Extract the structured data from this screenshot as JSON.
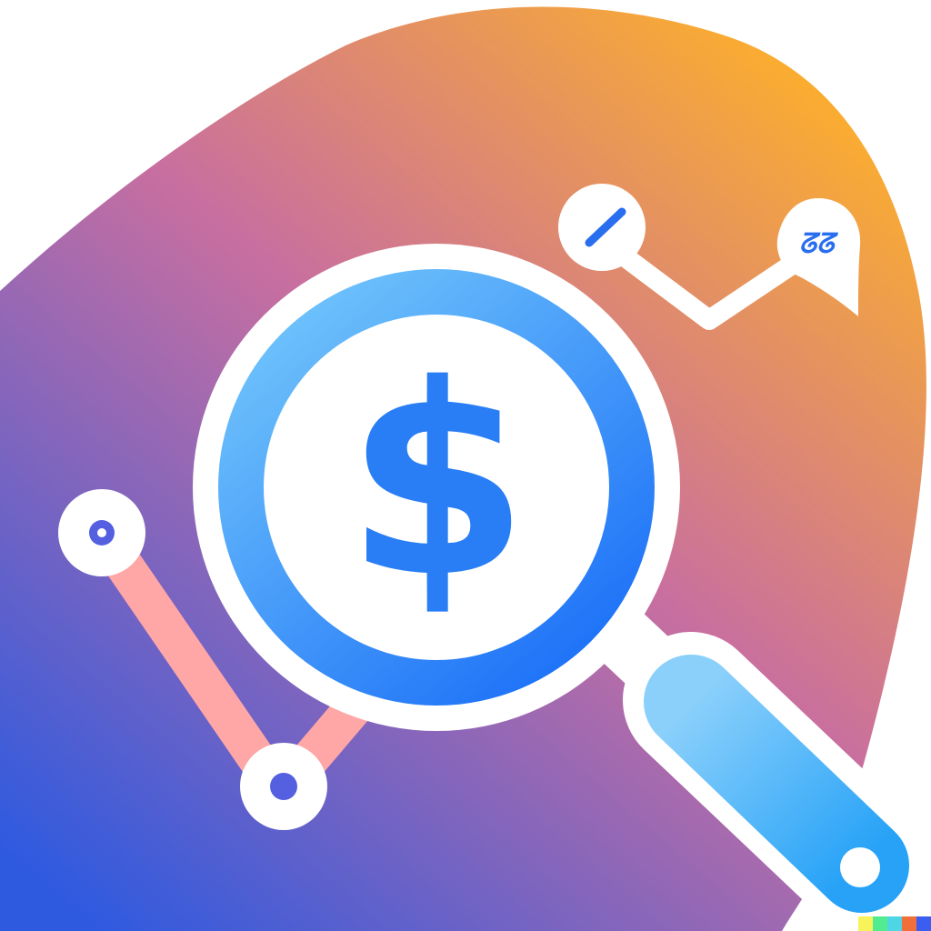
{
  "icon": {
    "currency_symbol": "$",
    "pin_glyph": "ᘔᘔ",
    "colors": {
      "blob_top": "#fdb02a",
      "blob_mid": "#c96f9f",
      "blob_bottom": "#2e5ae0",
      "white": "#ffffff",
      "lens_light": "#6ec2fb",
      "lens_dark": "#1a6ef7",
      "dollar_blue": "#2a7ef5",
      "chart_line_pink": "#ffa6a6",
      "chart_dot_blue": "#5560e0",
      "handle_light": "#8bd0fb",
      "handle_dark": "#27a2f7",
      "pin_glyph_blue": "#2a6ef0"
    }
  },
  "watermark": {
    "colors": [
      "#f7f35a",
      "#53eb8f",
      "#4fd6e5",
      "#f26f3a",
      "#3c5ef0"
    ]
  }
}
